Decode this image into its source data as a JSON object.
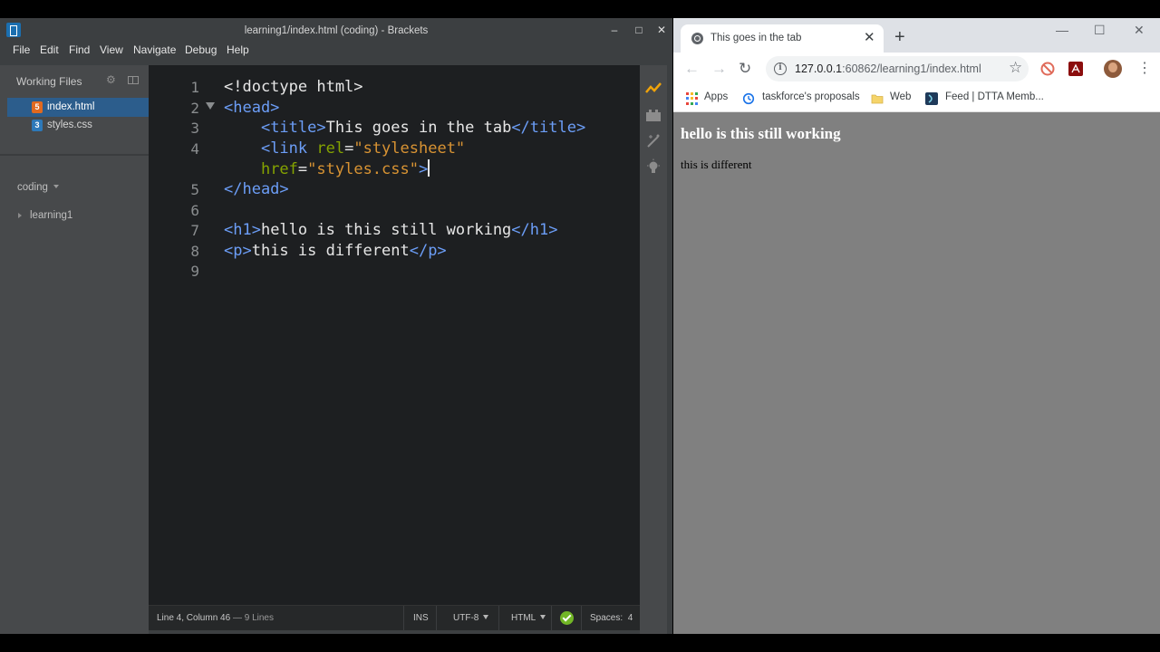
{
  "brackets": {
    "window_title": "learning1/index.html (coding) - Brackets",
    "controls": {
      "minimize": "–",
      "maximize": "□",
      "close": "✕"
    },
    "menu": [
      "File",
      "Edit",
      "Find",
      "View",
      "Navigate",
      "Debug",
      "Help"
    ],
    "sidebar": {
      "working_files_label": "Working Files",
      "files": [
        {
          "name": "index.html",
          "icon": "html-file-icon",
          "active": true
        },
        {
          "name": "styles.css",
          "icon": "css-file-icon",
          "active": false
        }
      ],
      "project_name": "coding",
      "tree": [
        {
          "name": "learning1",
          "type": "folder"
        }
      ]
    },
    "editor": {
      "line_numbers": [
        "1",
        "2",
        "3",
        "4",
        "",
        "5",
        "6",
        "7",
        "8",
        "9"
      ],
      "lines": [
        [
          {
            "t": "<!doctype html>",
            "c": "txt"
          }
        ],
        [
          {
            "t": "<head>",
            "c": "tag"
          }
        ],
        [
          {
            "t": "    ",
            "c": "txt"
          },
          {
            "t": "<title>",
            "c": "tag"
          },
          {
            "t": "This goes in the tab",
            "c": "txt"
          },
          {
            "t": "</title>",
            "c": "tag"
          }
        ],
        [
          {
            "t": "    ",
            "c": "txt"
          },
          {
            "t": "<link",
            "c": "tag"
          },
          {
            "t": " rel",
            "c": "attr"
          },
          {
            "t": "=",
            "c": "txt"
          },
          {
            "t": "\"stylesheet\"",
            "c": "str"
          }
        ],
        [
          {
            "t": "    ",
            "c": "txt"
          },
          {
            "t": "href",
            "c": "attr"
          },
          {
            "t": "=",
            "c": "txt"
          },
          {
            "t": "\"styles.css\"",
            "c": "str"
          },
          {
            "t": ">",
            "c": "tag"
          }
        ],
        [
          {
            "t": "</head>",
            "c": "tag"
          }
        ],
        [
          {
            "t": "",
            "c": "txt"
          }
        ],
        [
          {
            "t": "<h1>",
            "c": "tag"
          },
          {
            "t": "hello is this still working",
            "c": "txt"
          },
          {
            "t": "</h1>",
            "c": "tag"
          }
        ],
        [
          {
            "t": "<p>",
            "c": "tag"
          },
          {
            "t": "this is different",
            "c": "txt"
          },
          {
            "t": "</p>",
            "c": "tag"
          }
        ],
        [
          {
            "t": "",
            "c": "txt"
          }
        ]
      ]
    },
    "statusbar": {
      "cursor": "Line 4, Column 46",
      "lines": "— 9 Lines",
      "mode": "INS",
      "encoding": "UTF-8",
      "language": "HTML",
      "spaces": "Spaces:  4"
    }
  },
  "chrome": {
    "tab_title": "This goes in the tab",
    "tab_close": "✕",
    "new_tab": "+",
    "controls": {
      "minimize": "—",
      "maximize": "☐",
      "close": "✕"
    },
    "url_host": "127.0.0.1",
    "url_rest": ":60862/learning1/index.html",
    "bookmarks": [
      "Apps",
      "taskforce's proposals",
      "Web",
      "Feed | DTTA Memb..."
    ],
    "page": {
      "h1": "hello is this still working",
      "p": "this is different",
      "background": "#808080"
    }
  }
}
